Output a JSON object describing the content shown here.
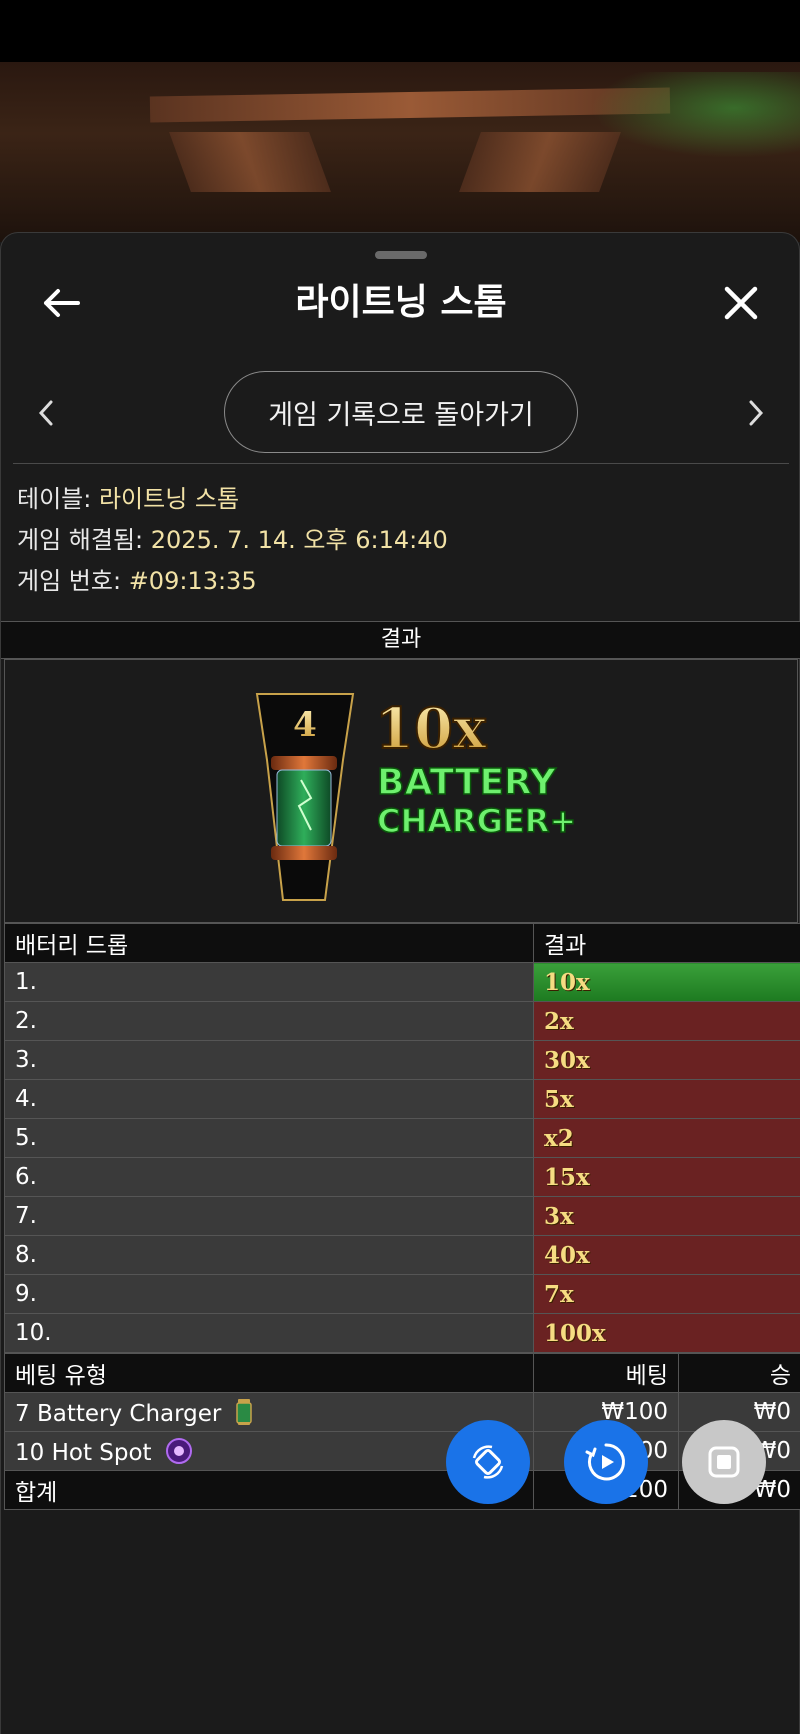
{
  "header": {
    "title": "라이트닝 스톰",
    "back_button": "게임 기록으로 돌아가기"
  },
  "info": {
    "table_label": "테이블:",
    "table_value": "라이트닝 스톰",
    "resolved_label": "게임 해결됨:",
    "resolved_value": "2025. 7. 14. 오후 6:14:40",
    "number_label": "게임 번호:",
    "number_value": "#09:13:35"
  },
  "result": {
    "heading": "결과",
    "art": {
      "number": "4",
      "multiplier": "10x",
      "line1": "BATTERY",
      "line2": "CHARGER+"
    }
  },
  "drops": {
    "col_drop": "배터리 드롭",
    "col_result": "결과",
    "rows": [
      {
        "n": "1.",
        "r": "10x",
        "win": true
      },
      {
        "n": "2.",
        "r": "2x"
      },
      {
        "n": "3.",
        "r": "30x"
      },
      {
        "n": "4.",
        "r": "5x"
      },
      {
        "n": "5.",
        "r": "x2"
      },
      {
        "n": "6.",
        "r": "15x"
      },
      {
        "n": "7.",
        "r": "3x"
      },
      {
        "n": "8.",
        "r": "40x"
      },
      {
        "n": "9.",
        "r": "7x"
      },
      {
        "n": "10.",
        "r": "100x"
      }
    ]
  },
  "bets": {
    "col_type": "베팅 유형",
    "col_bet": "베팅",
    "col_win": "승",
    "rows": [
      {
        "type": "7 Battery Charger",
        "bet": "₩100",
        "win": "₩0",
        "icon": "battery-icon"
      },
      {
        "type": "10 Hot Spot",
        "bet": "₩100",
        "win": "₩0",
        "icon": "hotspot-icon"
      }
    ],
    "total_label": "합계",
    "total_bet": "₩200",
    "total_win": "₩0"
  },
  "colors": {
    "win_green": "#2e9a2e",
    "lose_red": "#6a2222",
    "accent_blue": "#1a73e8",
    "gold": "#f6dc82"
  }
}
